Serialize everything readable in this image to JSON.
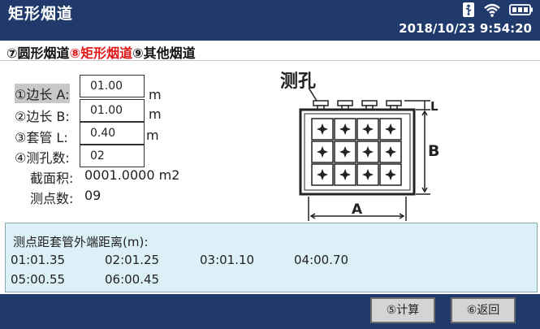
{
  "header": {
    "title": "矩形烟道",
    "datetime": "2018/10/23 9:54:20",
    "icons": [
      "usb-icon",
      "wifi-icon",
      "battery-icon"
    ]
  },
  "tabs": [
    {
      "label": "⑦圆形烟道",
      "active": false
    },
    {
      "label": "⑧矩形烟道",
      "active": true
    },
    {
      "label": "⑨其他烟道",
      "active": false
    }
  ],
  "form": {
    "side_a": {
      "label": "①边长 A:",
      "value": "01.00",
      "unit": "m"
    },
    "side_b": {
      "label": "②边长 B:",
      "value": "01.00",
      "unit": "m"
    },
    "sleeve": {
      "label": "③套管 L:",
      "value": "0.40",
      "unit": "m"
    },
    "holes": {
      "label": "④测孔数:",
      "value": "02"
    },
    "area": {
      "label": "截面积:",
      "value": "0001.0000 m2"
    },
    "points": {
      "label": "测点数:",
      "value": "09"
    }
  },
  "diagram": {
    "hole_label": "测孔",
    "dim_a": "A",
    "dim_b": "B",
    "dim_l": "L"
  },
  "distances": {
    "title": "测点距套管外端距离(m):",
    "items": [
      "01:01.35",
      "02:01.25",
      "03:01.10",
      "04:00.70",
      "05:00.55",
      "06:00.45"
    ]
  },
  "footer": {
    "calc_label": "⑤计算",
    "back_label": "⑥返回"
  },
  "colors": {
    "titlebar": "#1f3a6b",
    "active_tab": "#e01818",
    "panel_bg": "#dcf0f8"
  }
}
